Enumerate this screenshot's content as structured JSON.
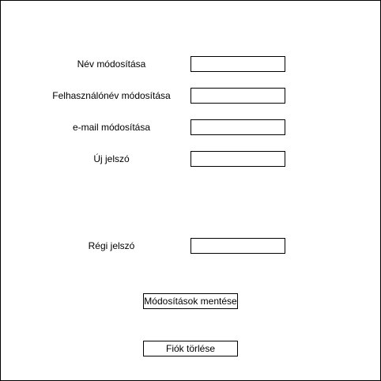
{
  "form": {
    "name_label": "Név módosítása",
    "name_value": "",
    "username_label": "Felhasználónév módosítása",
    "username_value": "",
    "email_label": "e-mail módosítása",
    "email_value": "",
    "new_password_label": "Új jelszó",
    "new_password_value": "",
    "old_password_label": "Régi jelszó",
    "old_password_value": ""
  },
  "actions": {
    "save_label": "Módosítások mentése",
    "delete_label": "Fiók törlése"
  }
}
